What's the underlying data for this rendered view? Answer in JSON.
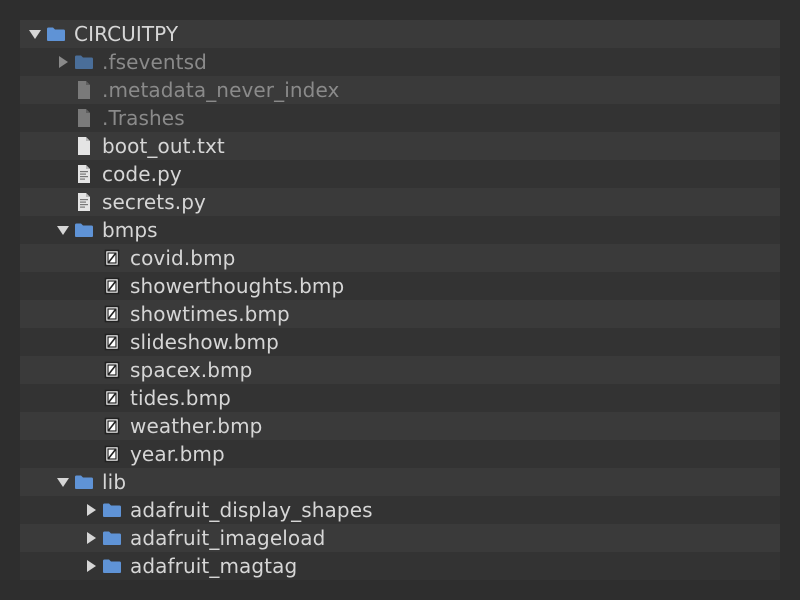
{
  "colors": {
    "folder": "#5f93d6",
    "folder_dim": "#4a6e99",
    "text": "#d6d6d6",
    "text_dim": "#8a8a8a"
  },
  "tree": [
    {
      "label": "CIRCUITPY",
      "kind": "folder",
      "expand": "open",
      "depth": 0,
      "dim": false
    },
    {
      "label": ".fseventsd",
      "kind": "folder",
      "expand": "closed",
      "depth": 1,
      "dim": true
    },
    {
      "label": ".metadata_never_index",
      "kind": "file",
      "expand": "none",
      "depth": 1,
      "dim": true
    },
    {
      "label": ".Trashes",
      "kind": "file",
      "expand": "none",
      "depth": 1,
      "dim": true
    },
    {
      "label": "boot_out.txt",
      "kind": "file",
      "expand": "none",
      "depth": 1,
      "dim": false
    },
    {
      "label": "code.py",
      "kind": "code",
      "expand": "none",
      "depth": 1,
      "dim": false
    },
    {
      "label": "secrets.py",
      "kind": "code",
      "expand": "none",
      "depth": 1,
      "dim": false
    },
    {
      "label": "bmps",
      "kind": "folder",
      "expand": "open",
      "depth": 1,
      "dim": false
    },
    {
      "label": "covid.bmp",
      "kind": "image",
      "expand": "none",
      "depth": 2,
      "dim": false
    },
    {
      "label": "showerthoughts.bmp",
      "kind": "image",
      "expand": "none",
      "depth": 2,
      "dim": false
    },
    {
      "label": "showtimes.bmp",
      "kind": "image",
      "expand": "none",
      "depth": 2,
      "dim": false
    },
    {
      "label": "slideshow.bmp",
      "kind": "image",
      "expand": "none",
      "depth": 2,
      "dim": false
    },
    {
      "label": "spacex.bmp",
      "kind": "image",
      "expand": "none",
      "depth": 2,
      "dim": false
    },
    {
      "label": "tides.bmp",
      "kind": "image",
      "expand": "none",
      "depth": 2,
      "dim": false
    },
    {
      "label": "weather.bmp",
      "kind": "image",
      "expand": "none",
      "depth": 2,
      "dim": false
    },
    {
      "label": "year.bmp",
      "kind": "image",
      "expand": "none",
      "depth": 2,
      "dim": false
    },
    {
      "label": "lib",
      "kind": "folder",
      "expand": "open",
      "depth": 1,
      "dim": false
    },
    {
      "label": "adafruit_display_shapes",
      "kind": "folder",
      "expand": "closed",
      "depth": 2,
      "dim": false
    },
    {
      "label": "adafruit_imageload",
      "kind": "folder",
      "expand": "closed",
      "depth": 2,
      "dim": false
    },
    {
      "label": "adafruit_magtag",
      "kind": "folder",
      "expand": "closed",
      "depth": 2,
      "dim": false
    }
  ]
}
